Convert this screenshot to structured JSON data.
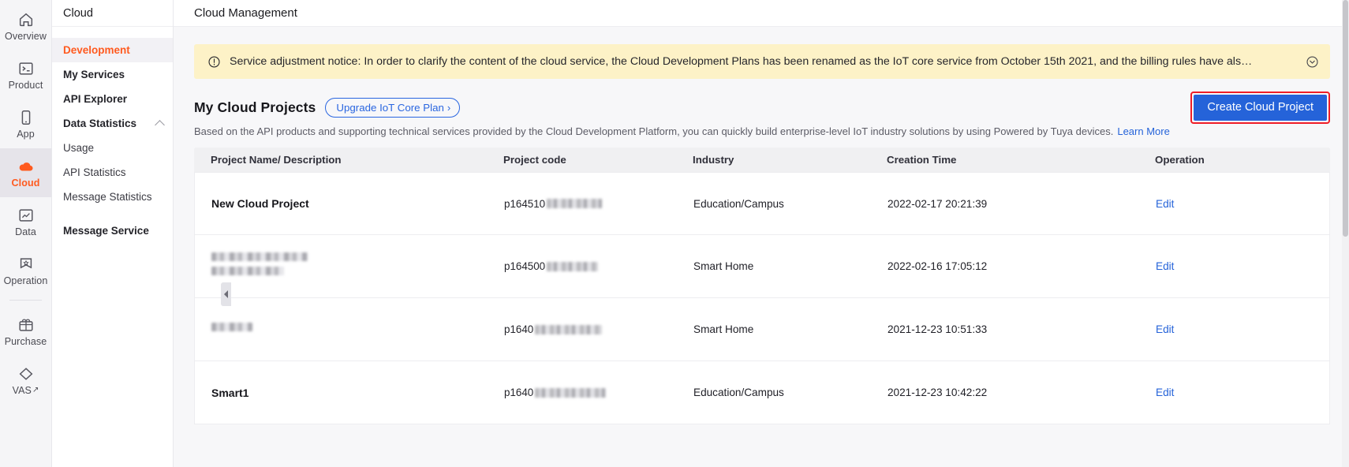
{
  "rail": {
    "items": [
      {
        "label": "Overview",
        "icon": "home-icon",
        "active": false
      },
      {
        "label": "Product",
        "icon": "terminal-icon",
        "active": false
      },
      {
        "label": "App",
        "icon": "phone-icon",
        "active": false
      },
      {
        "label": "Cloud",
        "icon": "cloud-icon",
        "active": true
      },
      {
        "label": "Data",
        "icon": "chart-icon",
        "active": false
      },
      {
        "label": "Operation",
        "icon": "badge-star-icon",
        "active": false
      },
      {
        "label": "Purchase",
        "icon": "box-icon",
        "active": false
      },
      {
        "label": "VAS",
        "icon": "diamond-icon",
        "active": false,
        "external": "↗"
      }
    ]
  },
  "subnav": {
    "title": "Cloud",
    "items": [
      {
        "label": "Development",
        "active": true,
        "sub": false
      },
      {
        "label": "My Services",
        "active": false,
        "sub": false
      },
      {
        "label": "API Explorer",
        "active": false,
        "sub": false
      },
      {
        "label": "Data Statistics",
        "active": false,
        "sub": false,
        "caret": "chevron-up-icon"
      },
      {
        "label": "Usage",
        "active": false,
        "sub": true
      },
      {
        "label": "API Statistics",
        "active": false,
        "sub": true
      },
      {
        "label": "Message Statistics",
        "active": false,
        "sub": true
      },
      {
        "label": "Message Service",
        "active": false,
        "sub": false,
        "gap_before": true
      }
    ]
  },
  "header": {
    "title": "Cloud Management"
  },
  "notice": {
    "icon": "info-circle-icon",
    "text": "Service adjustment notice: In order to clarify the content of the cloud service, the Cloud Development Plans has been renamed as the IoT core service from October 15th 2021, and the billing rules have als…",
    "expand_icon": "chevron-down-circle-icon",
    "bg_color": "#fdf2c7"
  },
  "projects": {
    "title": "My Cloud Projects",
    "upgrade_label": "Upgrade IoT Core Plan",
    "upgrade_chevron": "›",
    "create_label": "Create Cloud Project",
    "create_color": "#2563d9",
    "highlight_color": "#ef1d27",
    "description": "Based on the API products and supporting technical services provided by the Cloud Development Platform, you can quickly build enterprise-level IoT industry solutions by using Powered by Tuya devices.",
    "learn_more": "Learn More"
  },
  "table": {
    "columns": [
      "Project Name/ Description",
      "Project code",
      "Industry",
      "Creation Time",
      "Operation"
    ],
    "rows": [
      {
        "name": "New Cloud Project",
        "name_redacted": false,
        "code_prefix": "p164510",
        "code_redacted_width": 70,
        "industry": "Education/Campus",
        "created": "2022-02-17 20:21:39",
        "action": "Edit"
      },
      {
        "name": "",
        "name_redacted": true,
        "name_redacted_widths": [
          122,
          92
        ],
        "code_prefix": "p164500",
        "code_redacted_width": 65,
        "industry": "Smart Home",
        "created": "2022-02-16 17:05:12",
        "action": "Edit"
      },
      {
        "name": "",
        "name_redacted": true,
        "name_redacted_widths": [
          52
        ],
        "code_prefix": "p1640",
        "code_redacted_width": 85,
        "industry": "Smart Home",
        "created": "2021-12-23 10:51:33",
        "action": "Edit"
      },
      {
        "name": "Smart1",
        "name_redacted": false,
        "code_prefix": "p1640",
        "code_redacted_width": 90,
        "industry": "Education/Campus",
        "created": "2021-12-23 10:42:22",
        "action": "Edit"
      }
    ]
  }
}
